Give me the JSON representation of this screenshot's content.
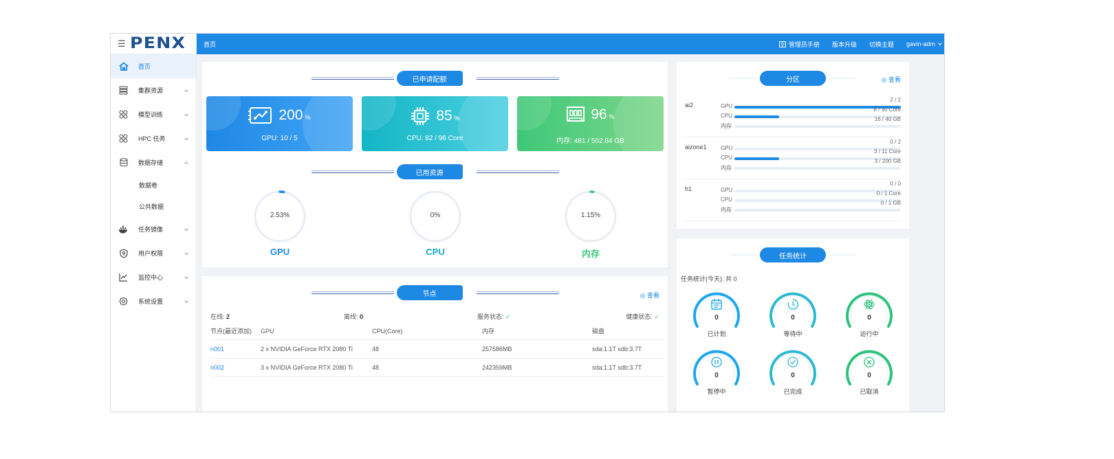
{
  "logo_text": "PENX",
  "topbar": {
    "breadcrumb": "首页",
    "manual": "管理员手册",
    "upgrade": "版本升级",
    "theme": "切换主题",
    "user": "gavin-adm"
  },
  "sidebar": {
    "items": [
      {
        "label": "首页",
        "icon": "home-icon"
      },
      {
        "label": "集群资源",
        "icon": "server-icon"
      },
      {
        "label": "模型训练",
        "icon": "model-icon"
      },
      {
        "label": "HPC 任务",
        "icon": "hpc-icon"
      },
      {
        "label": "数据存储",
        "icon": "database-icon"
      },
      {
        "label": "任务镜像",
        "icon": "docker-icon"
      },
      {
        "label": "用户权限",
        "icon": "shield-icon"
      },
      {
        "label": "监控中心",
        "icon": "chart-icon"
      },
      {
        "label": "系统设置",
        "icon": "gear-icon"
      }
    ],
    "sub_items": [
      "数据卷",
      "公共数据"
    ]
  },
  "quota": {
    "title": "已申请配额",
    "cards": [
      {
        "percent": "200",
        "unit": "%",
        "detail": "GPU: 10 / 5",
        "color_from": "#1e88e5",
        "color_to": "#42a5f5"
      },
      {
        "percent": "85",
        "unit": "%",
        "detail": "CPU: 82 / 96 Core",
        "color_from": "#13b5c6",
        "color_to": "#4dd0e1"
      },
      {
        "percent": "96",
        "unit": "%",
        "detail": "内存: 481 / 502.84 GB",
        "color_from": "#3ec878",
        "color_to": "#7ed58a"
      }
    ]
  },
  "usage": {
    "title": "已用资源",
    "rings": [
      {
        "value": "2.53%",
        "fraction": 0.0253,
        "name": "GPU",
        "color": "#1e88e5"
      },
      {
        "value": "0%",
        "fraction": 0,
        "name": "CPU",
        "color": "#18a9c9"
      },
      {
        "value": "1.15%",
        "fraction": 0.0115,
        "name": "内存",
        "color": "#3ec878"
      }
    ]
  },
  "nodes": {
    "title": "节点",
    "view": "查看",
    "online_label": "在线:",
    "online": "2",
    "offline_label": "离线:",
    "offline": "0",
    "service_label": "服务状态:",
    "health_label": "健康状态:",
    "columns": [
      "节点(最近添加)",
      "GPU",
      "CPU(Core)",
      "内存",
      "磁盘"
    ],
    "rows": [
      {
        "name": "n001",
        "gpu": "2 x NVIDIA GeForce RTX 2080 Ti",
        "cpu": "48",
        "mem": "257586MB",
        "disk": "sda:1.1T sdb:3.7T"
      },
      {
        "name": "n002",
        "gpu": "3 x NVIDIA GeForce RTX 2080 Ti",
        "cpu": "48",
        "mem": "242359MB",
        "disk": "sda:1.1T sdb:3.7T"
      }
    ]
  },
  "partitions": {
    "title": "分区",
    "view": "查看",
    "list": [
      {
        "name": "ai2",
        "bars": [
          {
            "label": "GPU",
            "count": "2 / 2",
            "fraction": 1.0
          },
          {
            "label": "CPU",
            "count": "8 / 30 Core",
            "fraction": 0.27
          },
          {
            "label": "内存",
            "count": "16 / 40 GB",
            "fraction": 0
          }
        ]
      },
      {
        "name": "aizone1",
        "bars": [
          {
            "label": "GPU",
            "count": "0 / 2",
            "fraction": 0
          },
          {
            "label": "CPU",
            "count": "3 / 11 Core",
            "fraction": 0.27
          },
          {
            "label": "内存",
            "count": "3 / 200 GB",
            "fraction": 0
          }
        ]
      },
      {
        "name": "h1",
        "bars": [
          {
            "label": "GPU",
            "count": "0 / 0",
            "fraction": 0
          },
          {
            "label": "CPU",
            "count": "0 / 1 Core",
            "fraction": 0
          },
          {
            "label": "内存",
            "count": "0 / 1 GB",
            "fraction": 0
          }
        ]
      }
    ]
  },
  "tasks": {
    "title": "任务统计",
    "summary": "任务统计(今天): 共 0",
    "items": [
      {
        "label": "已计划",
        "count": "0",
        "icon": "calendar-icon",
        "color": "#1ea7ef"
      },
      {
        "label": "等待中",
        "count": "0",
        "icon": "clock-icon",
        "color": "#2fb9d0"
      },
      {
        "label": "运行中",
        "count": "0",
        "icon": "atom-icon",
        "color": "#2ec27e"
      },
      {
        "label": "暂停中",
        "count": "0",
        "icon": "pause-icon",
        "color": "#1ea7ef"
      },
      {
        "label": "已完成",
        "count": "0",
        "icon": "check-icon",
        "color": "#2fb9d0"
      },
      {
        "label": "已取消",
        "count": "0",
        "icon": "cancel-icon",
        "color": "#2ec27e"
      }
    ]
  }
}
